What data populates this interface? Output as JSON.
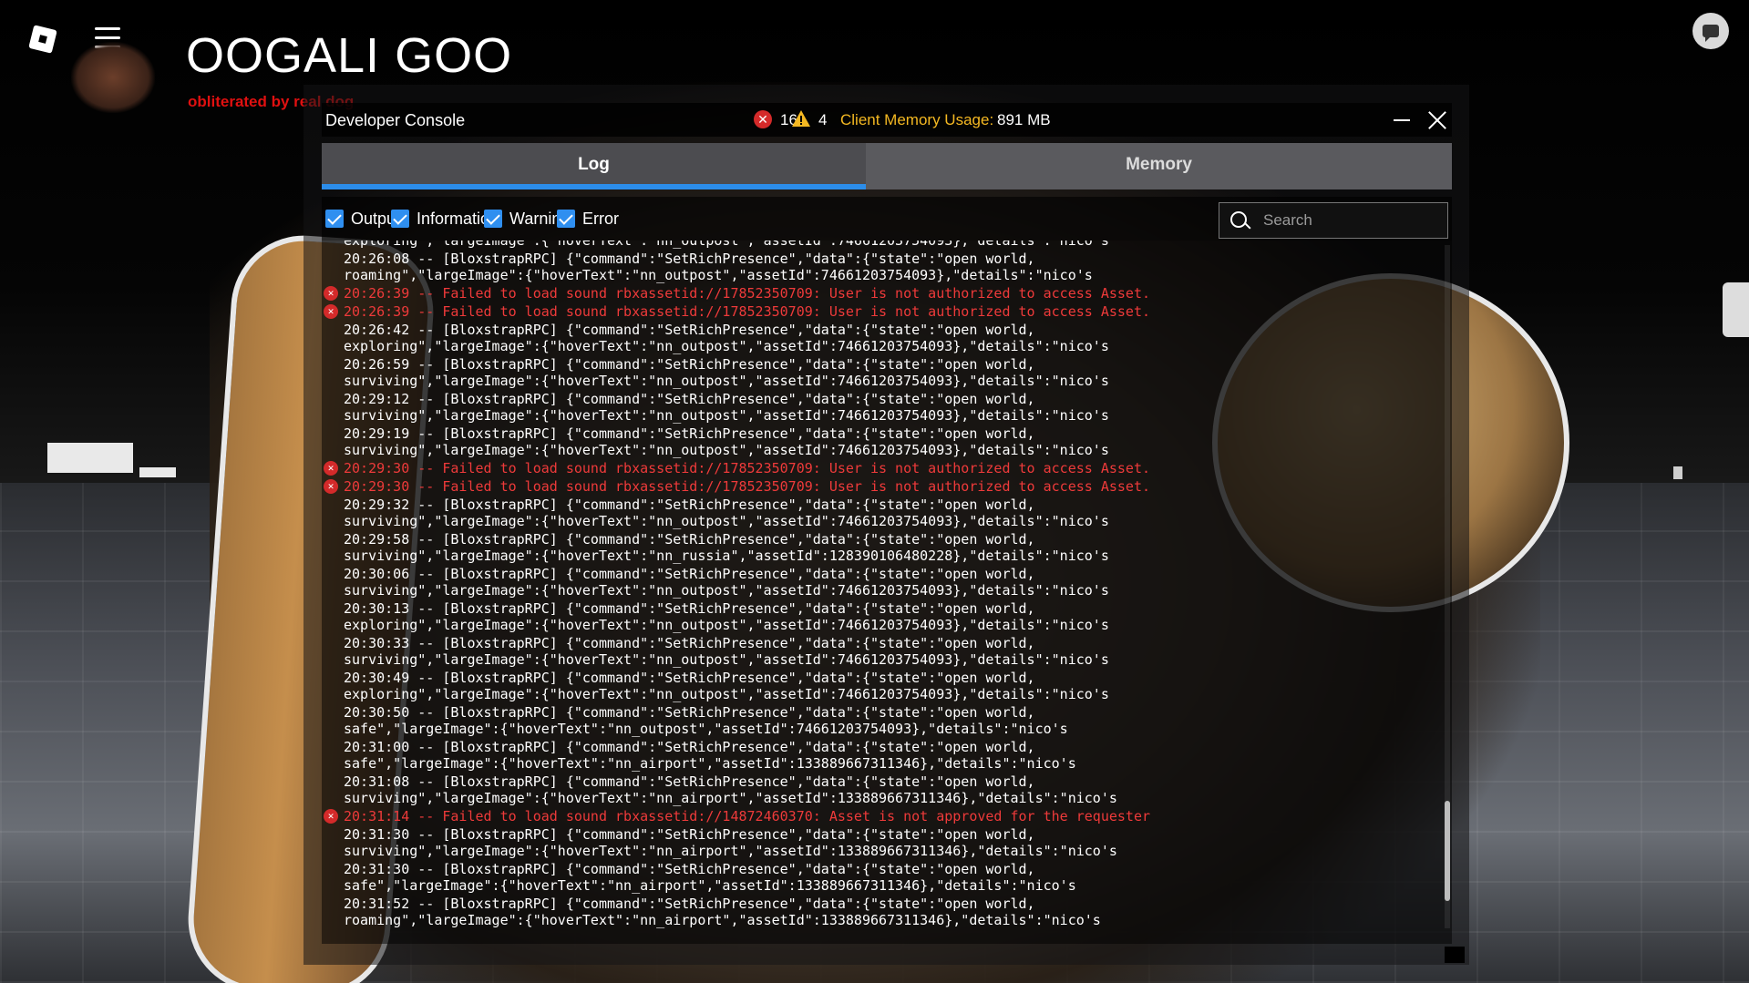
{
  "hud": {
    "game_title": "OOGALI GOO",
    "subtitle": "obliterated by real dog"
  },
  "console": {
    "title": "Developer Console",
    "error_count": "16",
    "warning_count": "4",
    "memory_label": "Client Memory Usage:",
    "memory_value": "891 MB",
    "tabs": [
      {
        "label": "Log"
      },
      {
        "label": "Memory"
      }
    ],
    "filters": [
      {
        "label": "Output"
      },
      {
        "label": "Information"
      },
      {
        "label": "Warning"
      },
      {
        "label": "Error"
      }
    ],
    "search_placeholder": "Search",
    "log": [
      {
        "type": "output",
        "text": "exploring\",\"largeImage\":{\"hoverText\":\"nn_outpost\",\"assetId\":74661203754093},\"details\":\"nico's"
      },
      {
        "type": "output",
        "text": "20:26:08 -- [BloxstrapRPC] {\"command\":\"SetRichPresence\",\"data\":{\"state\":\"open world,\nroaming\",\"largeImage\":{\"hoverText\":\"nn_outpost\",\"assetId\":74661203754093},\"details\":\"nico's"
      },
      {
        "type": "error",
        "text": "20:26:39 -- Failed to load sound rbxassetid://17852350709: User is not authorized to access Asset."
      },
      {
        "type": "error",
        "text": "20:26:39 -- Failed to load sound rbxassetid://17852350709: User is not authorized to access Asset."
      },
      {
        "type": "output",
        "text": "20:26:42 -- [BloxstrapRPC] {\"command\":\"SetRichPresence\",\"data\":{\"state\":\"open world,\nexploring\",\"largeImage\":{\"hoverText\":\"nn_outpost\",\"assetId\":74661203754093},\"details\":\"nico's"
      },
      {
        "type": "output",
        "text": "20:26:59 -- [BloxstrapRPC] {\"command\":\"SetRichPresence\",\"data\":{\"state\":\"open world,\nsurviving\",\"largeImage\":{\"hoverText\":\"nn_outpost\",\"assetId\":74661203754093},\"details\":\"nico's"
      },
      {
        "type": "output",
        "text": "20:29:12 -- [BloxstrapRPC] {\"command\":\"SetRichPresence\",\"data\":{\"state\":\"open world,\nsurviving\",\"largeImage\":{\"hoverText\":\"nn_outpost\",\"assetId\":74661203754093},\"details\":\"nico's"
      },
      {
        "type": "output",
        "text": "20:29:19 -- [BloxstrapRPC] {\"command\":\"SetRichPresence\",\"data\":{\"state\":\"open world,\nsurviving\",\"largeImage\":{\"hoverText\":\"nn_outpost\",\"assetId\":74661203754093},\"details\":\"nico's"
      },
      {
        "type": "error",
        "text": "20:29:30 -- Failed to load sound rbxassetid://17852350709: User is not authorized to access Asset."
      },
      {
        "type": "error",
        "text": "20:29:30 -- Failed to load sound rbxassetid://17852350709: User is not authorized to access Asset."
      },
      {
        "type": "output",
        "text": "20:29:32 -- [BloxstrapRPC] {\"command\":\"SetRichPresence\",\"data\":{\"state\":\"open world,\nsurviving\",\"largeImage\":{\"hoverText\":\"nn_outpost\",\"assetId\":74661203754093},\"details\":\"nico's"
      },
      {
        "type": "output",
        "text": "20:29:58 -- [BloxstrapRPC] {\"command\":\"SetRichPresence\",\"data\":{\"state\":\"open world,\nsurviving\",\"largeImage\":{\"hoverText\":\"nn_russia\",\"assetId\":128390106480228},\"details\":\"nico's"
      },
      {
        "type": "output",
        "text": "20:30:06 -- [BloxstrapRPC] {\"command\":\"SetRichPresence\",\"data\":{\"state\":\"open world,\nsurviving\",\"largeImage\":{\"hoverText\":\"nn_outpost\",\"assetId\":74661203754093},\"details\":\"nico's"
      },
      {
        "type": "output",
        "text": "20:30:13 -- [BloxstrapRPC] {\"command\":\"SetRichPresence\",\"data\":{\"state\":\"open world,\nexploring\",\"largeImage\":{\"hoverText\":\"nn_outpost\",\"assetId\":74661203754093},\"details\":\"nico's"
      },
      {
        "type": "output",
        "text": "20:30:33 -- [BloxstrapRPC] {\"command\":\"SetRichPresence\",\"data\":{\"state\":\"open world,\nsurviving\",\"largeImage\":{\"hoverText\":\"nn_outpost\",\"assetId\":74661203754093},\"details\":\"nico's"
      },
      {
        "type": "output",
        "text": "20:30:49 -- [BloxstrapRPC] {\"command\":\"SetRichPresence\",\"data\":{\"state\":\"open world,\nexploring\",\"largeImage\":{\"hoverText\":\"nn_outpost\",\"assetId\":74661203754093},\"details\":\"nico's"
      },
      {
        "type": "output",
        "text": "20:30:50 -- [BloxstrapRPC] {\"command\":\"SetRichPresence\",\"data\":{\"state\":\"open world,\nsafe\",\"largeImage\":{\"hoverText\":\"nn_outpost\",\"assetId\":74661203754093},\"details\":\"nico's"
      },
      {
        "type": "output",
        "text": "20:31:00 -- [BloxstrapRPC] {\"command\":\"SetRichPresence\",\"data\":{\"state\":\"open world,\nsafe\",\"largeImage\":{\"hoverText\":\"nn_airport\",\"assetId\":133889667311346},\"details\":\"nico's"
      },
      {
        "type": "output",
        "text": "20:31:08 -- [BloxstrapRPC] {\"command\":\"SetRichPresence\",\"data\":{\"state\":\"open world,\nsurviving\",\"largeImage\":{\"hoverText\":\"nn_airport\",\"assetId\":133889667311346},\"details\":\"nico's"
      },
      {
        "type": "error",
        "text": "20:31:14 -- Failed to load sound rbxassetid://14872460370: Asset is not approved for the requester"
      },
      {
        "type": "output",
        "text": "20:31:30 -- [BloxstrapRPC] {\"command\":\"SetRichPresence\",\"data\":{\"state\":\"open world,\nsurviving\",\"largeImage\":{\"hoverText\":\"nn_airport\",\"assetId\":133889667311346},\"details\":\"nico's"
      },
      {
        "type": "output",
        "text": "20:31:30 -- [BloxstrapRPC] {\"command\":\"SetRichPresence\",\"data\":{\"state\":\"open world,\nsafe\",\"largeImage\":{\"hoverText\":\"nn_airport\",\"assetId\":133889667311346},\"details\":\"nico's"
      },
      {
        "type": "output",
        "text": "20:31:52 -- [BloxstrapRPC] {\"command\":\"SetRichPresence\",\"data\":{\"state\":\"open world,\nroaming\",\"largeImage\":{\"hoverText\":\"nn_airport\",\"assetId\":133889667311346},\"details\":\"nico's"
      }
    ]
  },
  "colors": {
    "accent": "#2c8dea",
    "error": "#ee3a3a",
    "memory_label": "#f4b822"
  }
}
